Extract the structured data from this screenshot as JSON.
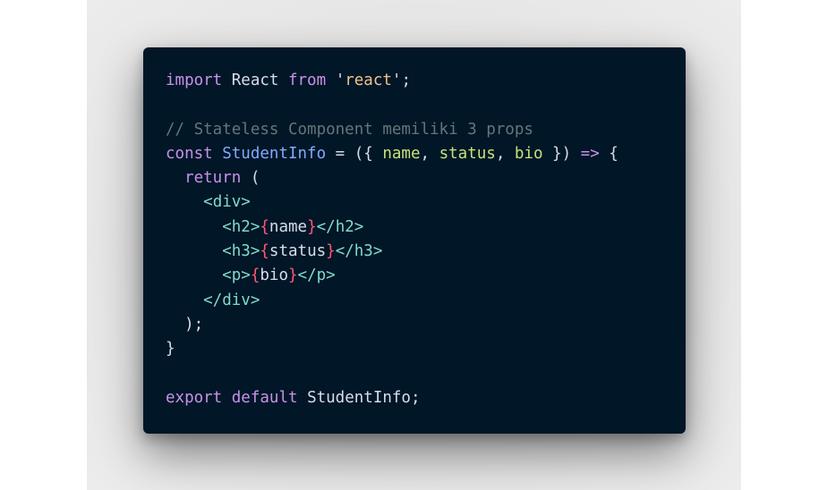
{
  "colors": {
    "background": "#011627",
    "keyword": "#c792ea",
    "identifier": "#82aaff",
    "string": "#ecc48d",
    "comment": "#637777",
    "parameter": "#c5e478",
    "jsx_tag": "#7fdbca",
    "jsx_brace": "#ff5874",
    "text": "#d6deeb"
  },
  "code": {
    "l1": {
      "kw_import": "import",
      "react": " React ",
      "kw_from": "from",
      "sp": " ",
      "q1": "'",
      "str": "react",
      "q2": "'",
      "end": ";"
    },
    "l3": {
      "comment": "// Stateless Component memiliki 3 props"
    },
    "l4": {
      "kw_const": "const",
      "sp1": " ",
      "name": "StudentInfo",
      "eq": " = ",
      "open": "({ ",
      "p1": "name",
      "c1": ", ",
      "p2": "status",
      "c2": ", ",
      "p3": "bio",
      "close": " }) ",
      "arrow": "=>",
      "brace": " {"
    },
    "l5": {
      "indent": "  ",
      "kw_return": "return",
      "paren": " ("
    },
    "l6": {
      "indent": "    ",
      "tag": "<div>"
    },
    "l7": {
      "indent": "      ",
      "open": "<h2>",
      "lb": "{",
      "val": "name",
      "rb": "}",
      "close": "</h2>"
    },
    "l8": {
      "indent": "      ",
      "open": "<h3>",
      "lb": "{",
      "val": "status",
      "rb": "}",
      "close": "</h3>"
    },
    "l9": {
      "indent": "      ",
      "open": "<p>",
      "lb": "{",
      "val": "bio",
      "rb": "}",
      "close": "</p>"
    },
    "l10": {
      "indent": "    ",
      "tag": "</div>"
    },
    "l11": {
      "text": "  );"
    },
    "l12": {
      "text": "}"
    },
    "l14": {
      "kw_export": "export",
      "sp": " ",
      "kw_default": "default",
      "rest": " StudentInfo;"
    }
  }
}
